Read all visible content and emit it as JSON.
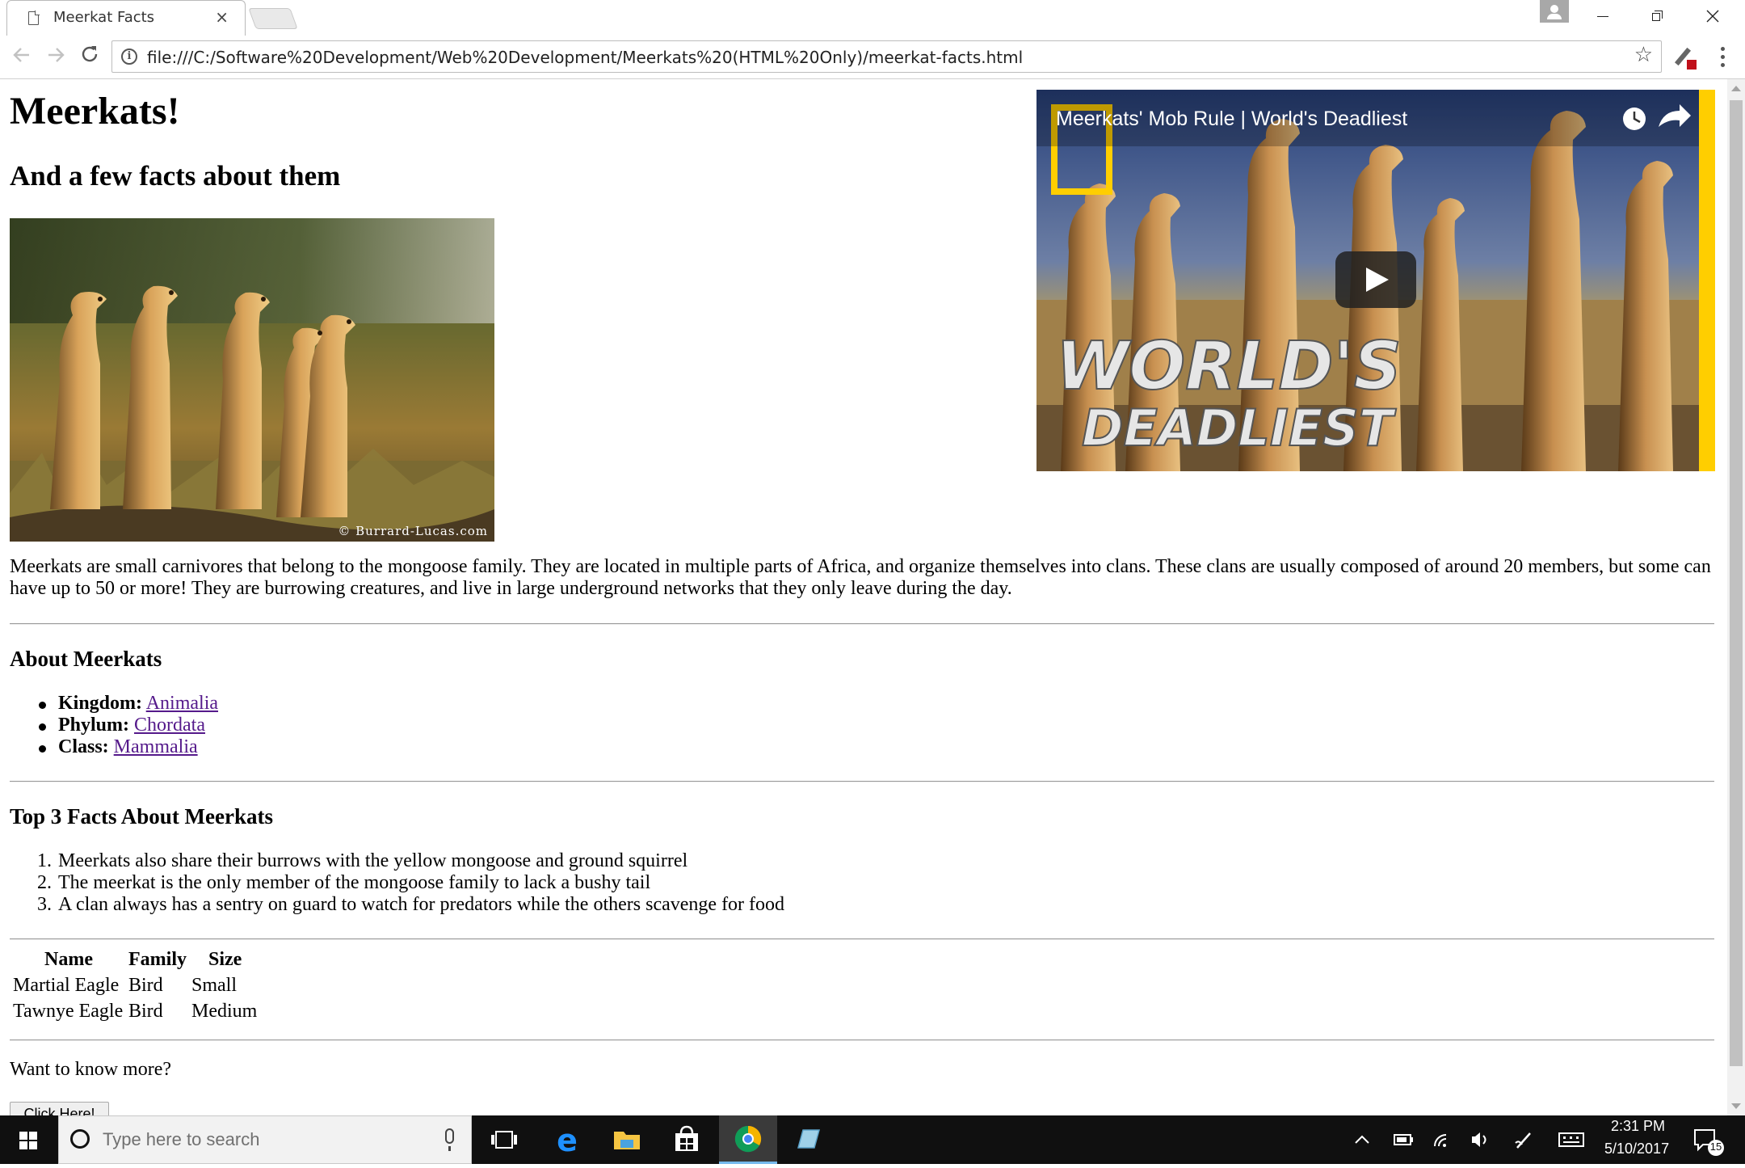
{
  "browser": {
    "tab_title": "Meerkat Facts",
    "tab_close": "×",
    "url": "file:///C:/Software%20Development/Web%20Development/Meerkats%20(HTML%20Only)/meerkat-facts.html",
    "window_controls": {
      "minimize": "—",
      "restore": "❐",
      "close": "✕"
    }
  },
  "page": {
    "title": "Meerkats!",
    "subtitle": "And a few facts about them",
    "photo_credit": "© Burrard-Lucas.com",
    "video": {
      "title": "Meerkats' Mob Rule | World's Deadliest",
      "overlay_line1": "WORLD'S",
      "overlay_line2": "DEADLIEST"
    },
    "intro": "Meerkats are small carnivores that belong to the mongoose family. They are located in multiple parts of Africa, and organize themselves into clans. These clans are usually composed of around 20 members, but some can have up to 50 or more! They are burrowing creatures, and live in large underground networks that they only leave during the day.",
    "about": {
      "heading": "About Meerkats",
      "items": [
        {
          "label": "Kingdom:",
          "link": "Animalia"
        },
        {
          "label": "Phylum:",
          "link": "Chordata"
        },
        {
          "label": "Class:",
          "link": "Mammalia"
        }
      ]
    },
    "facts": {
      "heading": "Top 3 Facts About Meerkats",
      "items": [
        {
          "num": "1.",
          "text": "Meerkats also share their burrows with the yellow mongoose and ground squirrel"
        },
        {
          "num": "2.",
          "text": "The meerkat is the only member of the mongoose family to lack a bushy tail"
        },
        {
          "num": "3.",
          "text": "A clan always has a sentry on guard to watch for predators while the others scavenge for food"
        }
      ]
    },
    "table": {
      "headers": [
        "Name",
        "Family",
        "Size"
      ],
      "rows": [
        [
          "Martial Eagle",
          "Bird",
          "Small"
        ],
        [
          "Tawnye Eagle",
          "Bird",
          "Medium"
        ]
      ]
    },
    "want_more": "Want to know more?",
    "button_label": "Click Here!"
  },
  "taskbar": {
    "search_placeholder": "Type here to search",
    "time": "2:31 PM",
    "date": "5/10/2017",
    "notification_count": "15"
  },
  "colors": {
    "link": "#551a8b",
    "taskbar": "#101010",
    "natgeo_yellow": "#ffce00"
  }
}
